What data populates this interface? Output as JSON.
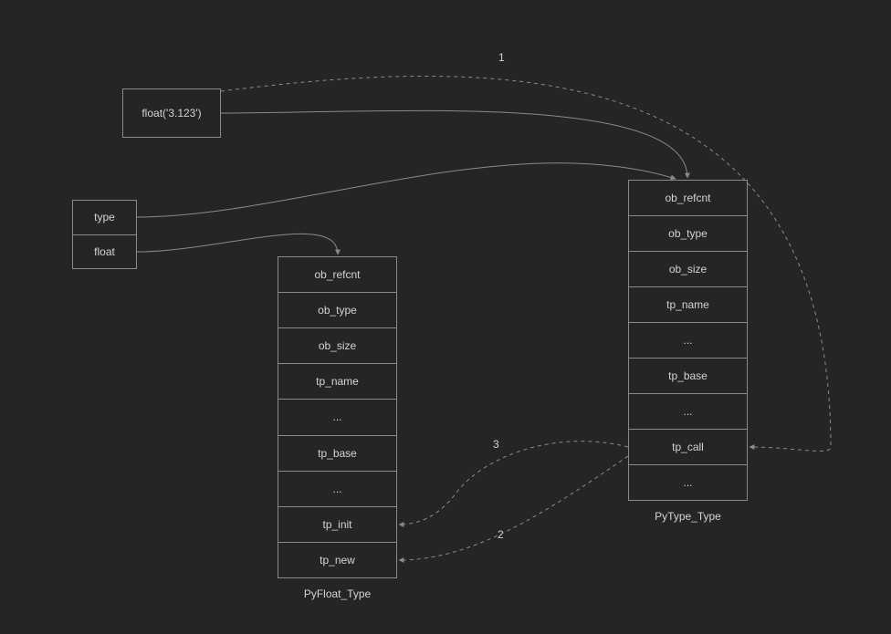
{
  "call_expr": "float('3.123')",
  "pair": {
    "top": "type",
    "bottom": "float"
  },
  "pyfloat": {
    "caption": "PyFloat_Type",
    "fields": [
      "ob_refcnt",
      "ob_type",
      "ob_size",
      "tp_name",
      "...",
      "tp_base",
      "...",
      "tp_init",
      "tp_new"
    ]
  },
  "pytype": {
    "caption": "PyType_Type",
    "fields": [
      "ob_refcnt",
      "ob_type",
      "ob_size",
      "tp_name",
      "...",
      "tp_base",
      "...",
      "tp_call",
      "..."
    ]
  },
  "edge_labels": {
    "one": "1",
    "two": "2",
    "three": "3"
  }
}
